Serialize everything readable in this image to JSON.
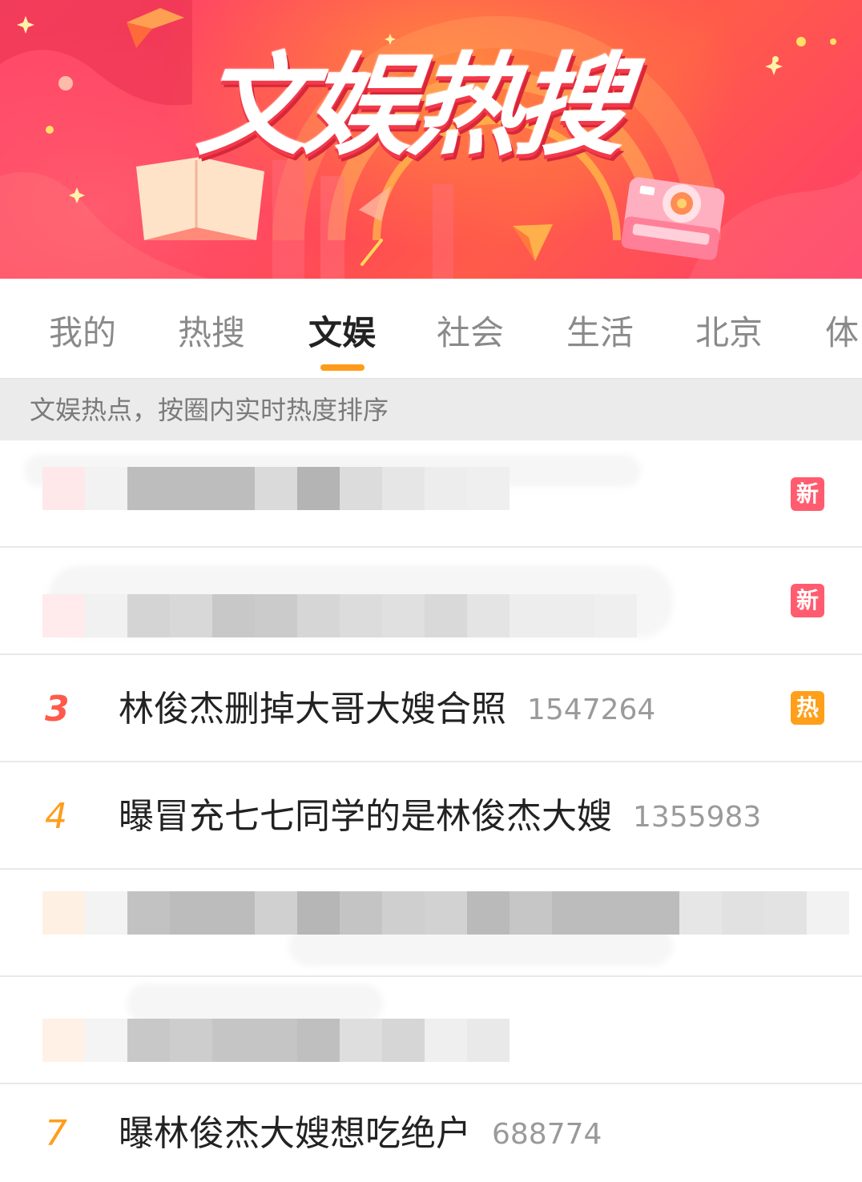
{
  "banner": {
    "title": "文娱热搜"
  },
  "tabs": [
    {
      "label": "我的",
      "active": false
    },
    {
      "label": "热搜",
      "active": false
    },
    {
      "label": "文娱",
      "active": true
    },
    {
      "label": "社会",
      "active": false
    },
    {
      "label": "生活",
      "active": false
    },
    {
      "label": "北京",
      "active": false
    },
    {
      "label": "体",
      "active": false
    }
  ],
  "subtitle": "文娱热点，按圈内实时热度排序",
  "list": [
    {
      "rank": "",
      "title": "",
      "count": "",
      "badge": "新",
      "badge_type": "new",
      "censored": true
    },
    {
      "rank": "",
      "title": "",
      "count": "",
      "badge": "新",
      "badge_type": "new",
      "censored": true
    },
    {
      "rank": "3",
      "title": "林俊杰删掉大哥大嫂合照",
      "count": "1547264",
      "badge": "热",
      "badge_type": "hot",
      "censored": false
    },
    {
      "rank": "4",
      "title": "曝冒充七七同学的是林俊杰大嫂",
      "count": "1355983",
      "badge": "",
      "badge_type": "",
      "censored": false
    },
    {
      "rank": "",
      "title": "",
      "count": "",
      "badge": "",
      "badge_type": "",
      "censored": true
    },
    {
      "rank": "",
      "title": "",
      "count": "",
      "badge": "",
      "badge_type": "",
      "censored": true
    },
    {
      "rank": "7",
      "title": "曝林俊杰大嫂想吃绝户",
      "count": "688774",
      "badge": "",
      "badge_type": "",
      "censored": false
    }
  ],
  "colors": {
    "accent_tab": "#ff9b1a",
    "rank_top": "#ff5a4a",
    "rank_mid": "#ff9d1e",
    "badge_new": "#ff5c6f",
    "badge_hot": "#ff9f1a"
  }
}
